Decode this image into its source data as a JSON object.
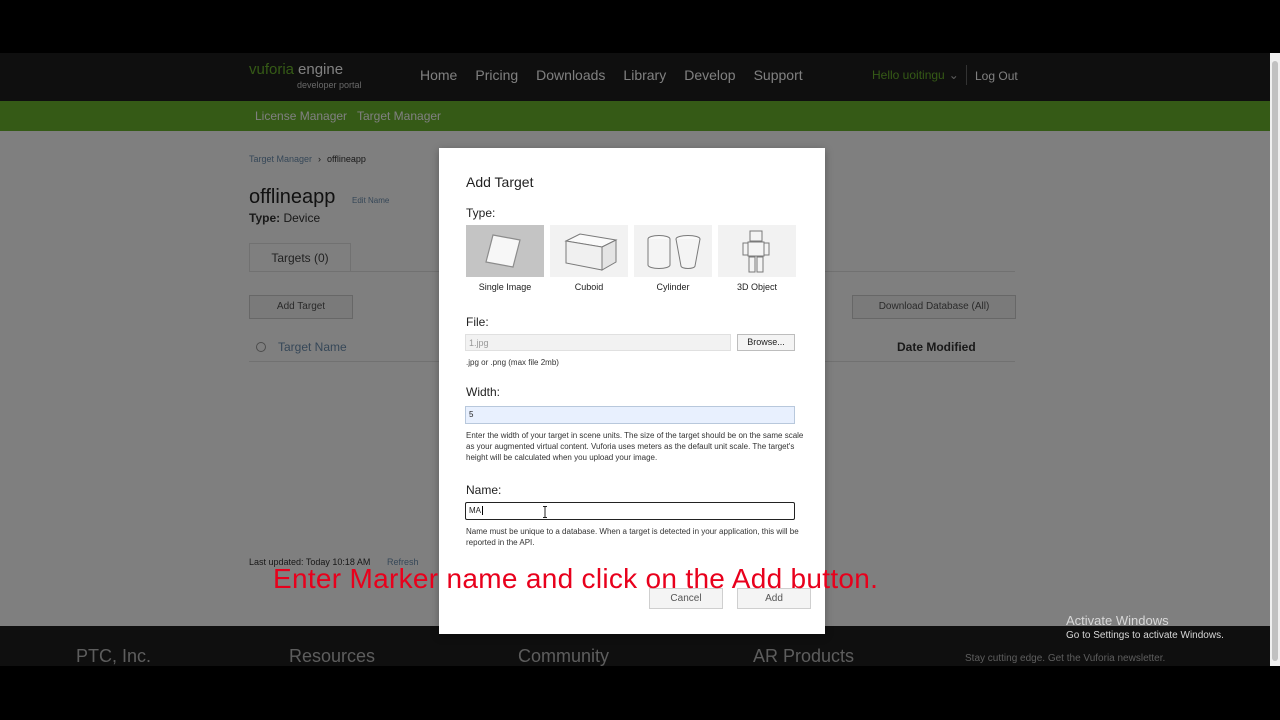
{
  "header": {
    "brand": "vuforia",
    "product": "engine",
    "subtitle": "developer portal",
    "nav": [
      "Home",
      "Pricing",
      "Downloads",
      "Library",
      "Develop",
      "Support"
    ],
    "greeting": "Hello uoitingu",
    "logout": "Log Out"
  },
  "subnav": {
    "license_manager": "License Manager",
    "target_manager": "Target Manager"
  },
  "page": {
    "breadcrumb_root": "Target Manager",
    "breadcrumb_current": "offlineapp",
    "title": "offlineapp",
    "edit_name": "Edit Name",
    "type_label": "Type:",
    "type_value": "Device",
    "tab_targets": "Targets (0)",
    "add_target_button": "Add Target",
    "download_button": "Download Database (All)",
    "col_target_name": "Target Name",
    "col_date_modified": "Date Modified",
    "last_updated": "Last updated: Today 10:18 AM",
    "refresh": "Refresh"
  },
  "footer": {
    "col1": "PTC, Inc.",
    "col2": "Resources",
    "col3": "Community",
    "col4": "AR Products",
    "newsletter": "Stay cutting edge. Get the Vuforia newsletter."
  },
  "modal": {
    "title": "Add Target",
    "type_label": "Type:",
    "types": [
      {
        "label": "Single Image",
        "icon": "single-image-icon",
        "selected": true
      },
      {
        "label": "Cuboid",
        "icon": "cuboid-icon",
        "selected": false
      },
      {
        "label": "Cylinder",
        "icon": "cylinder-icon",
        "selected": false
      },
      {
        "label": "3D Object",
        "icon": "3d-object-icon",
        "selected": false
      }
    ],
    "file_label": "File:",
    "file_value": "1.jpg",
    "browse_label": "Browse...",
    "file_hint": ".jpg or .png (max file 2mb)",
    "width_label": "Width:",
    "width_value": "5",
    "width_hint": "Enter the width of your target in scene units. The size of the target should be on the same scale as your augmented virtual content. Vuforia uses meters as the default unit scale. The target's height will be calculated when you upload your image.",
    "name_label": "Name:",
    "name_value": "MA",
    "name_hint": "Name must be unique to a database. When a target is detected in your application, this will be reported in the API.",
    "cancel_label": "Cancel",
    "add_label": "Add"
  },
  "caption": "Enter Marker name and click on the Add button.",
  "windows_watermark": {
    "line1": "Activate Windows",
    "line2": "Go to Settings to activate Windows."
  }
}
